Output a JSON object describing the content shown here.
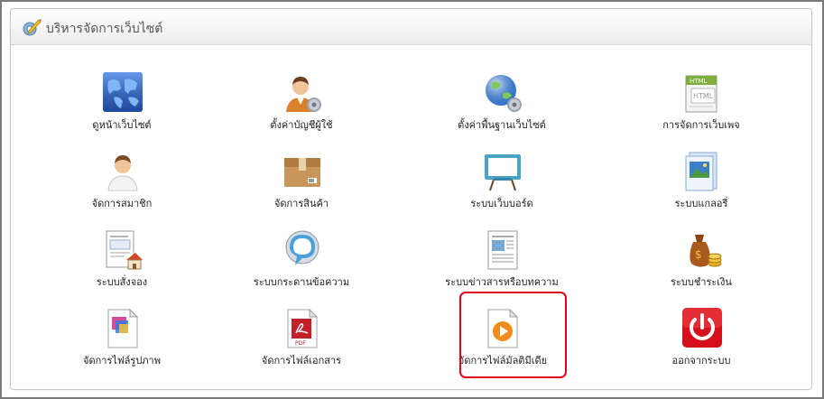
{
  "panel": {
    "title": "บริหารจัดการเว็บไซต์"
  },
  "items": [
    {
      "label": "ดูหน้าเว็บไซต์",
      "icon": "globe-icon"
    },
    {
      "label": "ตั้งค่าบัญชีผู้ใช้",
      "icon": "user-settings-icon"
    },
    {
      "label": "ตั้งค่าพื้นฐานเว็บไซต์",
      "icon": "globe-settings-icon"
    },
    {
      "label": "การจัดการเว็บเพจ",
      "icon": "html-page-icon"
    },
    {
      "label": "จัดการสมาชิก",
      "icon": "member-icon"
    },
    {
      "label": "จัดการสินค้า",
      "icon": "product-box-icon"
    },
    {
      "label": "ระบบเว็บบอร์ด",
      "icon": "whiteboard-icon"
    },
    {
      "label": "ระบบแกลอรี่",
      "icon": "gallery-icon"
    },
    {
      "label": "ระบบสั่งจอง",
      "icon": "reservation-form-icon"
    },
    {
      "label": "ระบบกระดานข้อความ",
      "icon": "message-bubble-icon"
    },
    {
      "label": "ระบบข่าวสารหรือบทความ",
      "icon": "newspaper-icon"
    },
    {
      "label": "ระบบชำระเงิน",
      "icon": "money-bag-icon"
    },
    {
      "label": "จัดการไฟล์รูปภาพ",
      "icon": "image-file-icon"
    },
    {
      "label": "จัดการไฟล์เอกสาร",
      "icon": "pdf-file-icon"
    },
    {
      "label": "จัดการไฟล์มัลติมีเดีย",
      "icon": "media-file-icon"
    },
    {
      "label": "ออกจากระบบ",
      "icon": "power-icon"
    }
  ],
  "highlighted_item": "จัดการไฟล์มัลติมีเดีย",
  "colors": {
    "highlight": "#e0001b",
    "power_red": "#d6101a"
  }
}
